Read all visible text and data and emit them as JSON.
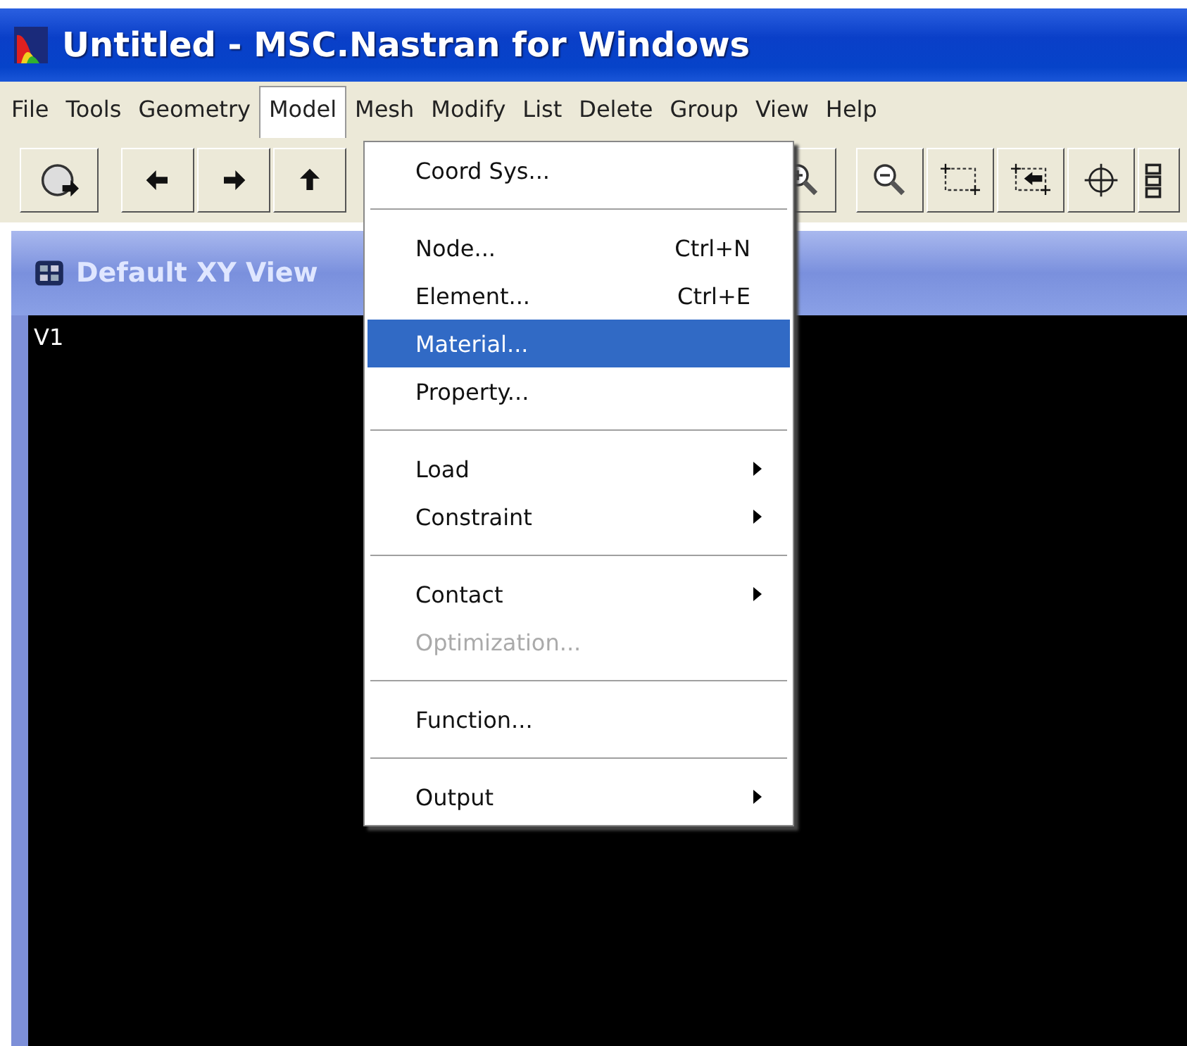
{
  "window": {
    "title": "Untitled - MSC.Nastran for Windows"
  },
  "menu_bar": [
    {
      "label": "File",
      "selected": false
    },
    {
      "label": "Tools",
      "selected": false
    },
    {
      "label": "Geometry",
      "selected": false
    },
    {
      "label": "Model",
      "selected": true
    },
    {
      "label": "Mesh",
      "selected": false
    },
    {
      "label": "Modify",
      "selected": false
    },
    {
      "label": "List",
      "selected": false
    },
    {
      "label": "Delete",
      "selected": false
    },
    {
      "label": "Group",
      "selected": false
    },
    {
      "label": "View",
      "selected": false
    },
    {
      "label": "Help",
      "selected": false
    }
  ],
  "toolbar_left": [
    {
      "kind": "circle"
    },
    {
      "kind": "left"
    },
    {
      "kind": "right"
    },
    {
      "kind": "up"
    }
  ],
  "toolbar_right": [
    {
      "kind": "zoom-in"
    },
    {
      "kind": "zoom-out"
    },
    {
      "kind": "zoom-box"
    },
    {
      "kind": "box-arrow"
    },
    {
      "kind": "crosshair"
    },
    {
      "kind": "partial"
    }
  ],
  "view_window": {
    "title": "Default XY View",
    "label": "V1"
  },
  "dropdown": [
    {
      "kind": "item",
      "label": "Coord Sys...",
      "selected": false,
      "disabled": false
    },
    {
      "kind": "separator"
    },
    {
      "kind": "item",
      "label": "Node...",
      "shortcut": "Ctrl+N",
      "selected": false,
      "disabled": false
    },
    {
      "kind": "item",
      "label": "Element...",
      "shortcut": "Ctrl+E",
      "selected": false,
      "disabled": false
    },
    {
      "kind": "item",
      "label": "Material...",
      "selected": true,
      "disabled": false
    },
    {
      "kind": "item",
      "label": "Property...",
      "selected": false,
      "disabled": false
    },
    {
      "kind": "separator"
    },
    {
      "kind": "submenu",
      "label": "Load",
      "selected": false,
      "disabled": false
    },
    {
      "kind": "submenu",
      "label": "Constraint",
      "selected": false,
      "disabled": false
    },
    {
      "kind": "separator"
    },
    {
      "kind": "submenu",
      "label": "Contact",
      "selected": false,
      "disabled": false
    },
    {
      "kind": "item",
      "label": "Optimization...",
      "selected": false,
      "disabled": true
    },
    {
      "kind": "separator"
    },
    {
      "kind": "item",
      "label": "Function...",
      "selected": false,
      "disabled": false
    },
    {
      "kind": "separator"
    },
    {
      "kind": "submenu",
      "label": "Output",
      "selected": false,
      "disabled": false
    }
  ]
}
